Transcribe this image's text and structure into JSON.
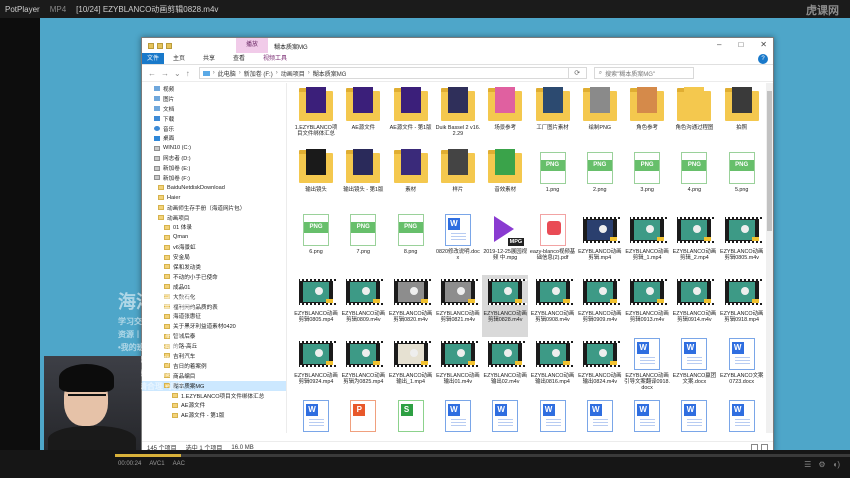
{
  "player": {
    "app": "PotPlayer",
    "format": "MP4",
    "title": "[10/24] EZYBLANCO动画剪辑0828.m4v",
    "watermark": "虎课网",
    "time": "00:00:24",
    "codec": "AVC1",
    "audio": "AAC",
    "progress": 0.09
  },
  "explorer": {
    "ctx_tab": "播放",
    "title": "糊本质案MG",
    "ribbon": [
      "文件",
      "主页",
      "共享",
      "查看",
      "视频工具"
    ],
    "address": [
      "此电脑",
      "新加卷 (F:)",
      "动画项目",
      "糊本质案MG"
    ],
    "search_placeholder": "搜索\"糊本质案MG\"",
    "status": {
      "count": "145 个项目",
      "selected": "选中 1 个项目",
      "size": "16.0 MB"
    }
  },
  "nav_tree": [
    {
      "label": "视频",
      "icon": "media"
    },
    {
      "label": "图片",
      "icon": "media"
    },
    {
      "label": "文档",
      "icon": "media"
    },
    {
      "label": "下载",
      "icon": "down"
    },
    {
      "label": "音乐",
      "icon": "music"
    },
    {
      "label": "桌面",
      "icon": "desk"
    },
    {
      "label": "WIN10 (C:)",
      "icon": "drive"
    },
    {
      "label": "网志者 (D:)",
      "icon": "drive"
    },
    {
      "label": "新加卷 (E:)",
      "icon": "drive"
    },
    {
      "label": "新加卷 (F:)",
      "icon": "drive"
    },
    {
      "label": "BaiduNetdiskDownload",
      "icon": "folder"
    },
    {
      "label": "Haier",
      "icon": "folder"
    },
    {
      "label": "动画师生存手册（海道网片包）",
      "icon": "folder"
    },
    {
      "label": "动画项目",
      "icon": "folder"
    },
    {
      "label": "01 体录",
      "icon": "folder"
    },
    {
      "label": "Qman",
      "icon": "folder"
    },
    {
      "label": "v6海景虹",
      "icon": "folder"
    },
    {
      "label": "安金局",
      "icon": "folder"
    },
    {
      "label": "保和发动类",
      "icon": "folder"
    },
    {
      "label": "不动的小手已使命",
      "icon": "folder"
    },
    {
      "label": "成品01",
      "icon": "folder"
    },
    {
      "label": "大数石化",
      "icon": "folder"
    },
    {
      "label": "福利网的品质的表",
      "icon": "folder"
    },
    {
      "label": "海道张惠征",
      "icon": "folder"
    },
    {
      "label": "关于黑牙利益道素材0420",
      "icon": "folder"
    },
    {
      "label": "管城后泰",
      "icon": "folder"
    },
    {
      "label": "的路-高丘",
      "icon": "folder"
    },
    {
      "label": "吉利汽车",
      "icon": "folder"
    },
    {
      "label": "吉日的着案例",
      "icon": "folder"
    },
    {
      "label": "商品编目",
      "icon": "folder"
    },
    {
      "label": "糊本质案MG",
      "icon": "folder",
      "selected": true
    },
    {
      "label": "1.EZYBLANCO项目文件绑体汇总",
      "icon": "folder"
    },
    {
      "label": "AE源文件",
      "icon": "folder"
    },
    {
      "label": "AE源文件 - 第1版",
      "icon": "folder"
    }
  ],
  "files": [
    {
      "name": "1.EZYBLANCO项目文件绑体汇总",
      "kind": "folder",
      "doc": "#3b1f7a"
    },
    {
      "name": "AE源文件",
      "kind": "folder",
      "doc": "#3b1f7a"
    },
    {
      "name": "AE源文件 - 第1版",
      "kind": "folder",
      "doc": "#3b1f7a"
    },
    {
      "name": "Duik Bassel 2 v16.2.29",
      "kind": "folder",
      "doc": "#2f2f5a"
    },
    {
      "name": "场景参考",
      "kind": "folder",
      "doc": "#e060a0"
    },
    {
      "name": "工厂图片素材",
      "kind": "folder",
      "doc": "#2c4a70"
    },
    {
      "name": "绘制PNG",
      "kind": "folder",
      "doc": "#8a8a8a"
    },
    {
      "name": "角色参考",
      "kind": "folder",
      "doc": "#d58a4a"
    },
    {
      "name": "角色沟通过程图",
      "kind": "folder",
      "doc": "#f4c84e"
    },
    {
      "name": "拍照",
      "kind": "folder",
      "doc": "#3a3a3a"
    },
    {
      "name": "输出镜头",
      "kind": "folder",
      "doc": "#1a1a1a"
    },
    {
      "name": "输出镜头 - 第1版",
      "kind": "folder",
      "doc": "#2a2a5a"
    },
    {
      "name": "素材",
      "kind": "folder",
      "doc": "#3a2a7a"
    },
    {
      "name": "样片",
      "kind": "folder",
      "doc": "#444"
    },
    {
      "name": "音效素材",
      "kind": "folder",
      "doc": "#3aa34a"
    },
    {
      "name": "1.png",
      "kind": "png"
    },
    {
      "name": "2.png",
      "kind": "png"
    },
    {
      "name": "3.png",
      "kind": "png"
    },
    {
      "name": "4.png",
      "kind": "png"
    },
    {
      "name": "5.png",
      "kind": "png"
    },
    {
      "name": "6.png",
      "kind": "png"
    },
    {
      "name": "7.png",
      "kind": "png"
    },
    {
      "name": "8.png",
      "kind": "png"
    },
    {
      "name": "0820修改说明.docx",
      "kind": "word"
    },
    {
      "name": "2019-12-25展园视频 中.mpg",
      "kind": "mpg"
    },
    {
      "name": "eazy-blanco视频基础信息(2).pdf",
      "kind": "pdf"
    },
    {
      "name": "EZYBLANCO动画剪辑.mp4",
      "kind": "video",
      "frame": "navy"
    },
    {
      "name": "EZYBLANCO动画剪辑_1.mp4",
      "kind": "video",
      "frame": "teal"
    },
    {
      "name": "EZYBLANCO动画剪辑_2.mp4",
      "kind": "video",
      "frame": "teal"
    },
    {
      "name": "EZYBLANCO动画剪辑0805.m4v",
      "kind": "video",
      "frame": "teal"
    },
    {
      "name": "EZYBLANCO动画剪辑0805.mp4",
      "kind": "video",
      "frame": "teal"
    },
    {
      "name": "EZYBLANCO动画剪辑0809.m4v",
      "kind": "video",
      "frame": "teal"
    },
    {
      "name": "EZYBLANCO动画剪辑0820.m4v",
      "kind": "video",
      "frame": "gray"
    },
    {
      "name": "EZYBLANCO动画剪辑0821.m4v",
      "kind": "video",
      "frame": "gray"
    },
    {
      "name": "EZYBLANCO动画剪辑0828.m4v",
      "kind": "video",
      "frame": "teal",
      "selected": true
    },
    {
      "name": "EZYBLANCO动画剪辑0908.m4v",
      "kind": "video",
      "frame": "teal"
    },
    {
      "name": "EZYBLANCO动画剪辑0909.m4v",
      "kind": "video",
      "frame": "teal"
    },
    {
      "name": "EZYBLANCO动画剪辑0913.m4v",
      "kind": "video",
      "frame": "teal"
    },
    {
      "name": "EZYBLANCO动画剪辑0914.m4v",
      "kind": "video",
      "frame": "teal"
    },
    {
      "name": "EZYBLANCO动画剪辑0918.mp4",
      "kind": "video",
      "frame": "teal"
    },
    {
      "name": "EZYBLANCO动画剪辑0924.mp4",
      "kind": "video",
      "frame": "teal"
    },
    {
      "name": "EZYBLANCO动画剪辑为0825.mp4",
      "kind": "video",
      "frame": "teal"
    },
    {
      "name": "EZYBLANCO动画输出_1.mp4",
      "kind": "video",
      "frame": "cream"
    },
    {
      "name": "EZYBLANCO动画输出01.m4v",
      "kind": "video",
      "frame": "teal"
    },
    {
      "name": "EZYBLANCO动画输出02.m4v",
      "kind": "video",
      "frame": "teal"
    },
    {
      "name": "EZYBLANCO动画输出0816.mp4",
      "kind": "video",
      "frame": "teal"
    },
    {
      "name": "EZYBLANCO动画输出0824.m4v",
      "kind": "video",
      "frame": "teal"
    },
    {
      "name": "EZYBLANCO动画引导文案翻译0918.docx",
      "kind": "word"
    },
    {
      "name": "EZYBLANCO赢团文案.docx",
      "kind": "word"
    },
    {
      "name": "EZYBLANCO文案0723.docx",
      "kind": "word"
    },
    {
      "name": "",
      "kind": "word"
    },
    {
      "name": "",
      "kind": "ppt"
    },
    {
      "name": "",
      "kind": "xls"
    },
    {
      "name": "",
      "kind": "word"
    },
    {
      "name": "",
      "kind": "word"
    },
    {
      "name": "",
      "kind": "word"
    },
    {
      "name": "",
      "kind": "word"
    },
    {
      "name": "",
      "kind": "word"
    },
    {
      "name": "",
      "kind": "word"
    },
    {
      "name": "",
      "kind": "word"
    }
  ],
  "overlay_text": {
    "big": "海洋 鱼鱼",
    "l1": "学习交流群",
    "l2": "资源丨素材丨教程",
    "l3": "•我的班学习 浪费!",
    "l4": "•找我换课 物降!",
    "l5": "•真诚私聊 •持续",
    "l6": "•参入 请合理 •调节"
  },
  "colors": {
    "accent": "#1979ca",
    "video_bg": "#4ea6c9",
    "folder": "#f4c84e",
    "selection": "#cce8ff"
  }
}
